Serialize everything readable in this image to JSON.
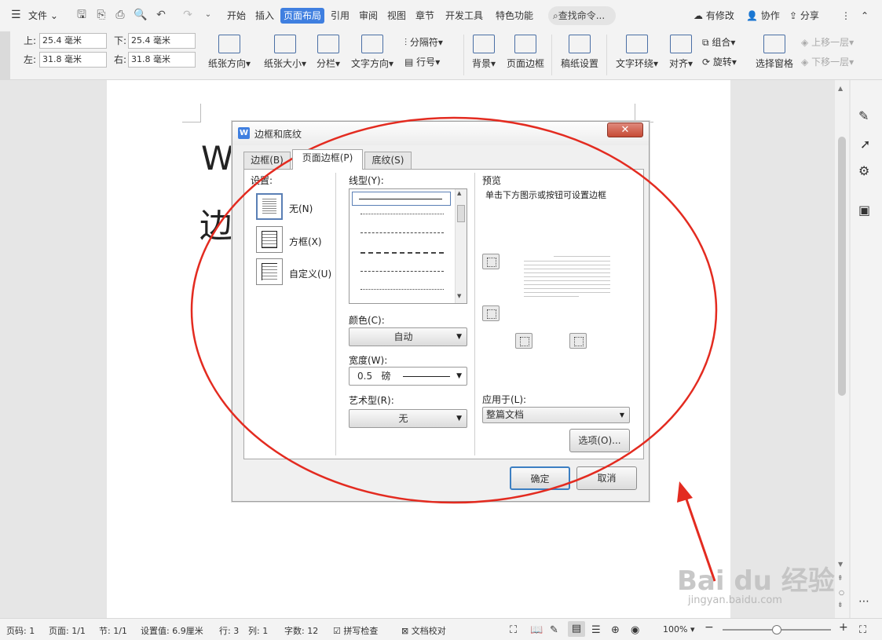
{
  "titlebar": {
    "file_menu": "文件",
    "menus": [
      "开始",
      "插入",
      "页面布局",
      "引用",
      "审阅",
      "视图",
      "章节",
      "开发工具",
      "特色功能"
    ],
    "active_menu": "页面布局",
    "search_label": "查找命令...",
    "modified": "有修改",
    "collab": "协作",
    "share": "分享"
  },
  "ribbon": {
    "margins": {
      "top_label": "上:",
      "top_value": "25.4 毫米",
      "bottom_label": "下:",
      "bottom_value": "25.4 毫米",
      "left_label": "左:",
      "left_value": "31.8 毫米",
      "right_label": "右:",
      "right_value": "31.8 毫米"
    },
    "orientation": "纸张方向",
    "size": "纸张大小",
    "columns": "分栏",
    "text_direction": "文字方向",
    "breaks": "分隔符",
    "line_numbers": "行号",
    "background": "背景",
    "page_border": "页面边框",
    "manuscript": "稿纸设置",
    "text_wrap": "文字环绕",
    "align": "对齐",
    "group": "组合",
    "rotate": "旋转",
    "selection_pane": "选择窗格",
    "bring_forward": "上移一层",
    "send_backward": "下移一层"
  },
  "document": {
    "heading_line1": "W",
    "heading_line2": "边"
  },
  "dialog": {
    "title": "边框和底纹",
    "tabs": [
      "边框(B)",
      "页面边框(P)",
      "底纹(S)"
    ],
    "active_tab": "页面边框(P)",
    "settings_label": "设置:",
    "settings": [
      "无(N)",
      "方框(X)",
      "自定义(U)"
    ],
    "style_label": "线型(Y):",
    "color_label": "颜色(C):",
    "color_value": "自动",
    "width_label": "宽度(W):",
    "width_value": "0.5",
    "width_unit": "磅",
    "art_label": "艺术型(R):",
    "art_value": "无",
    "preview_label": "预览",
    "preview_hint": "单击下方图示或按钮可设置边框",
    "apply_label": "应用于(L):",
    "apply_value": "整篇文档",
    "options_button": "选项(O)...",
    "ok_button": "确定",
    "cancel_button": "取消"
  },
  "statusbar": {
    "page_no": "页码: 1",
    "pages": "页面: 1/1",
    "section": "节: 1/1",
    "setting": "设置值: 6.9厘米",
    "row": "行: 3",
    "col": "列: 1",
    "words": "字数: 12",
    "spell": "拼写检查",
    "proof": "文档校对",
    "zoom": "100%",
    "zoom_level": 0.5
  },
  "watermark": {
    "brand": "Bai du 经验",
    "url": "jingyan.baidu.com"
  },
  "colors": {
    "accent": "#3f7fe0",
    "annotation": "#e32b20"
  }
}
